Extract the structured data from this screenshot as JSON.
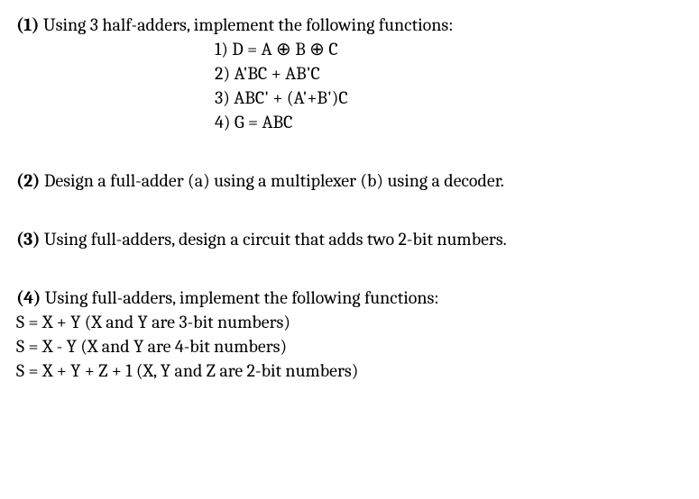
{
  "problems": [
    {
      "number": "(1)",
      "prompt": "Using 3 half-adders, implement the following functions:",
      "sub_indent": "center",
      "subs": [
        "1) D = A ⊕ B ⊕ C",
        "2) A'BC + AB'C",
        "3) ABC' + (A'+B')C",
        "4) G = ABC"
      ]
    },
    {
      "number": "(2)",
      "prompt": "Design a full-adder (a) using a multiplexer (b) using a decoder.",
      "subs": []
    },
    {
      "number": "(3)",
      "prompt": "Using full-adders, design a circuit that adds two 2-bit numbers.",
      "subs": []
    },
    {
      "number": "(4)",
      "prompt": "Using full-adders, implement the following functions:",
      "sub_indent": "left",
      "subs": [
        "S = X + Y (X and Y are 3-bit numbers)",
        "S = X - Y  (X and Y are 4-bit numbers)",
        "S = X + Y + Z + 1 (X, Y and Z are 2-bit numbers)"
      ]
    }
  ]
}
